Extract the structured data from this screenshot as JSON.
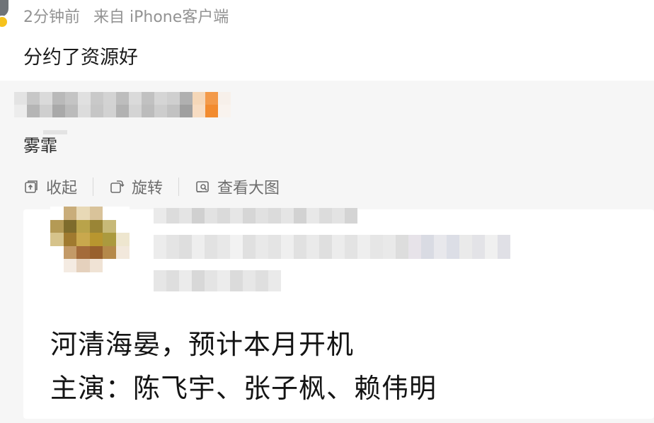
{
  "post": {
    "time": "2分钟前",
    "source": "来自 iPhone客户端",
    "text": "分约了资源好"
  },
  "repost": {
    "text": "雾霏",
    "actions": [
      {
        "label": "收起",
        "icon": "collapse-icon"
      },
      {
        "label": "旋转",
        "icon": "rotate-icon"
      },
      {
        "label": "查看大图",
        "icon": "view-large-image-icon"
      }
    ]
  },
  "image_card": {
    "line1": "河清海晏，预计本月开机",
    "line2": "主演：陈飞宇、张子枫、赖伟明"
  }
}
